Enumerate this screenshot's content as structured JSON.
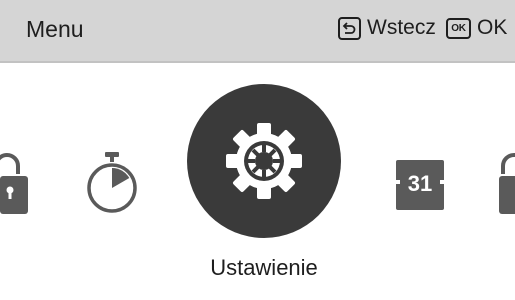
{
  "header": {
    "title": "Menu",
    "back_label": "Wstecz",
    "ok_key_label": "OK",
    "ok_label": "OK"
  },
  "menu": {
    "items": [
      {
        "icon": "lock-icon"
      },
      {
        "icon": "timer-icon"
      },
      {
        "icon": "gear-icon",
        "label": "Ustawienie",
        "selected": true
      },
      {
        "icon": "calendar-icon",
        "number": "31"
      },
      {
        "icon": "lock-icon"
      }
    ],
    "selected_label": "Ustawienie"
  },
  "colors": {
    "header_bg": "#d5d5d5",
    "icon_gray": "#5a5a5a",
    "selected_bg": "#3a3a3a",
    "text": "#1e1e1e"
  }
}
